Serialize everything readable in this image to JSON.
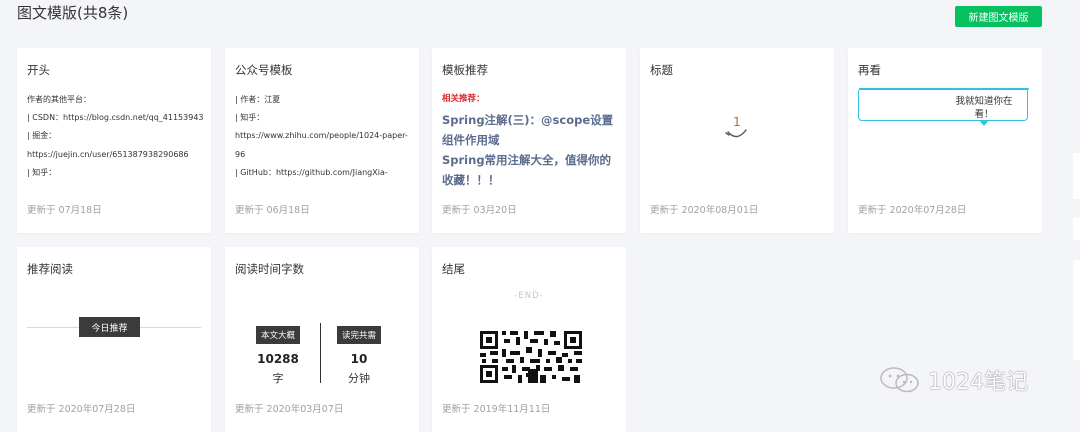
{
  "header": {
    "title": "图文模版(共8条)",
    "new_button": "新建图文模版"
  },
  "cards": {
    "c1": {
      "title": "开头",
      "lines": [
        "作者的其他平台：",
        "| CSDN：https://blog.csdn.net/qq_41153943",
        "| 掘金：",
        "https://juejin.cn/user/651387938290686",
        "| 知乎："
      ],
      "footer": "更新于 07月18日"
    },
    "c2": {
      "title": "公众号模板",
      "lines": [
        "| 作者：江夏",
        "| 知乎：",
        "https://www.zhihu.com/people/1024-paper-",
        "96",
        "| GitHub：https://github.com/JiangXia-"
      ],
      "footer": "更新于 06月18日"
    },
    "c3": {
      "title": "模板推荐",
      "label": "相关推荐：",
      "links": [
        "Spring注解(三)：@scope设置组件作用域",
        "Spring常用注解大全，值得你的收藏！！！"
      ],
      "footer": "更新于 03月20日"
    },
    "c4": {
      "title": "标题",
      "number": "1",
      "footer": "更新于 2020年08月01日"
    },
    "c5": {
      "title": "再看",
      "bubble_text": "我就知道你在看！",
      "footer": "更新于 2020年07月28日"
    },
    "c6": {
      "title": "推荐阅读",
      "tag": "今日推荐",
      "footer": "更新于 2020年07月28日"
    },
    "c7": {
      "title": "阅读时间字数",
      "left_tag": "本文大概",
      "left_value": "10288",
      "left_unit": "字",
      "right_tag": "读完共需",
      "right_value": "10",
      "right_unit": "分钟",
      "footer": "更新于 2020年03月07日"
    },
    "c8": {
      "title": "结尾",
      "end_mark": "-END-",
      "footer": "更新于 2019年11月11日"
    }
  },
  "watermark": "1024笔记",
  "colors": {
    "accent": "#07c160",
    "related_red": "#e0262e",
    "link_blue": "#5b6c8d",
    "bubble_cyan": "#2fc3e0",
    "page_bg": "#f4f5f9"
  }
}
